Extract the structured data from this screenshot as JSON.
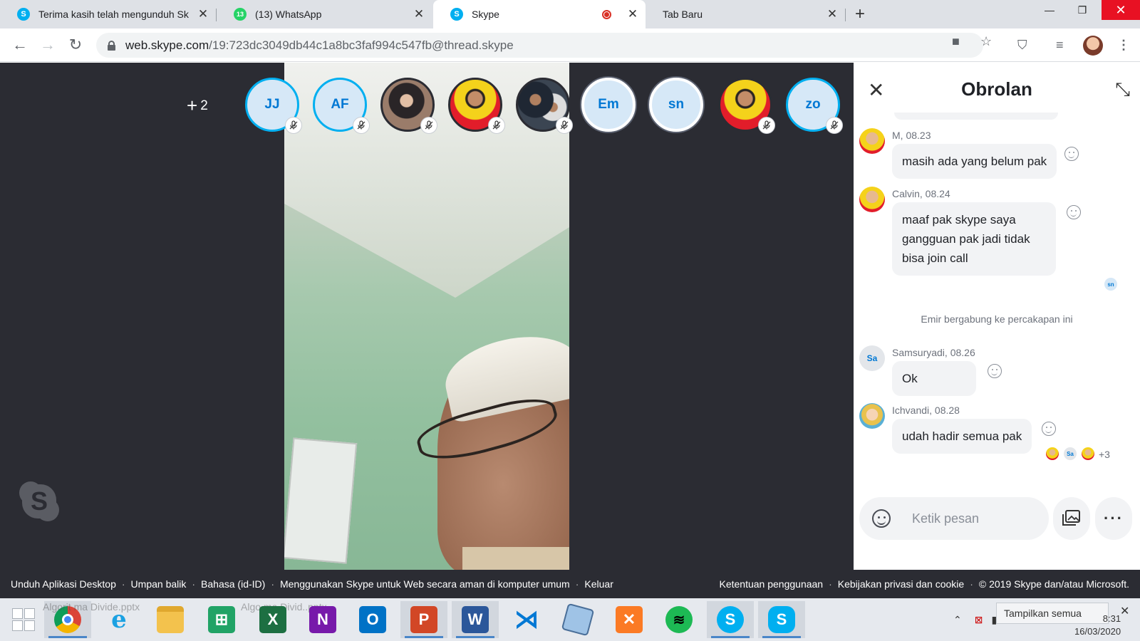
{
  "browser": {
    "tabs": [
      {
        "title": "Terima kasih telah mengunduh Sk",
        "favicon": "skype-icon",
        "color": "#00aff0"
      },
      {
        "title": "(13) WhatsApp",
        "favicon": "whatsapp-icon",
        "badge": "13",
        "color": "#25d366"
      },
      {
        "title": "Skype",
        "favicon": "skype-icon",
        "color": "#00aff0",
        "recording": true
      },
      {
        "title": "Tab Baru"
      }
    ],
    "url_host": "web.skype.com",
    "url_path": "/19:723dc3049db44c1a8bc3faf994c547fb@thread.skype"
  },
  "call": {
    "more_participants": "2",
    "participants": [
      {
        "initials": "JJ",
        "muted": true,
        "kind": "initials"
      },
      {
        "initials": "AF",
        "muted": true,
        "kind": "initials"
      },
      {
        "initials": "",
        "muted": true,
        "kind": "photo",
        "photo_desc": "woman-hijab"
      },
      {
        "initials": "",
        "muted": true,
        "kind": "photo",
        "photo_desc": "man-yellow-jacket-red-bg"
      },
      {
        "initials": "",
        "muted": true,
        "kind": "photo",
        "photo_desc": "group-photo"
      },
      {
        "initials": "Em",
        "muted": false,
        "kind": "initials",
        "active": true
      },
      {
        "initials": "sn",
        "muted": false,
        "kind": "initials",
        "active": true
      },
      {
        "initials": "",
        "muted": true,
        "kind": "photo",
        "photo_desc": "man-yellow-jacket-red-bg"
      },
      {
        "initials": "zo",
        "muted": true,
        "kind": "initials"
      }
    ]
  },
  "chat": {
    "title": "Obrolan",
    "messages": [
      {
        "sender": "M",
        "time": "08.23",
        "meta": "M, 08.23",
        "text": "masih ada yang belum pak",
        "avatar": "photo"
      },
      {
        "sender": "Calvin",
        "time": "08.24",
        "meta": "Calvin, 08.24",
        "text": "maaf pak skype saya gangguan pak jadi tidak bisa join call",
        "avatar": "photo"
      },
      {
        "sender": "Samsuryadi",
        "time": "08.26",
        "meta": "Samsuryadi, 08.26",
        "text": "Ok",
        "avatar": "Sa"
      },
      {
        "sender": "Ichvandi",
        "time": "08.28",
        "meta": "Ichvandi, 08.28",
        "text": "udah hadir semua pak",
        "avatar": "photo"
      }
    ],
    "read_receipt_single": "sn",
    "system_note": "Emir bergabung ke percakapan ini",
    "read_receipts": [
      "photo",
      "Sa",
      "photo"
    ],
    "read_more": "+3",
    "composer_placeholder": "Ketik pesan"
  },
  "footer": {
    "left_links": [
      "Unduh Aplikasi Desktop",
      "Umpan balik",
      "Bahasa (id-ID)",
      "Menggunakan Skype untuk Web secara aman di komputer umum",
      "Keluar"
    ],
    "right_links": [
      "Ketentuan penggunaan",
      "Kebijakan privasi dan cookie",
      "© 2019 Skype dan/atau Microsoft."
    ]
  },
  "taskbar": {
    "apps": [
      "windows-start",
      "chrome",
      "internet-explorer",
      "file-explorer",
      "excel-green",
      "excel",
      "onenote",
      "outlook",
      "powerpoint",
      "word",
      "vscode",
      "virtualbox",
      "xampp",
      "spotify",
      "skype",
      "skype"
    ],
    "ghost_text_1": "Algorit ma Divide.pptx",
    "ghost_text_2": "Algo ma Divid..pptx",
    "notification": "Tampilkan semua",
    "time": "8:31",
    "date": "16/03/2020"
  }
}
